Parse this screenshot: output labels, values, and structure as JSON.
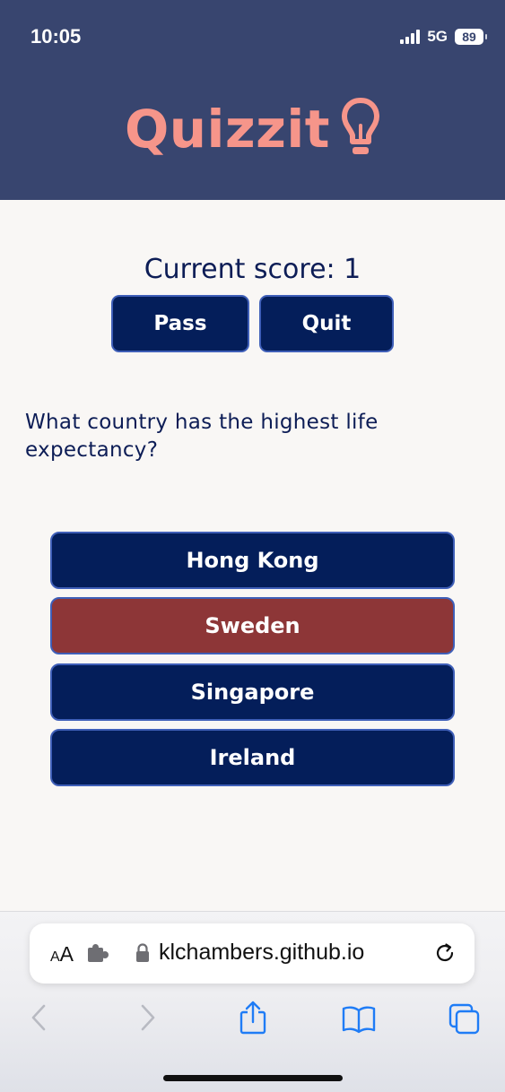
{
  "status_bar": {
    "time": "10:05",
    "network": "5G",
    "battery": "89"
  },
  "header": {
    "brand_title": "Quizzit",
    "brand_icon": "lightbulb-icon",
    "brand_color": "#f6958a",
    "background": "#38456f"
  },
  "game": {
    "score_label": "Current score: 1",
    "pass_label": "Pass",
    "quit_label": "Quit",
    "question": "What country has the highest life expectancy?",
    "answers": [
      {
        "label": "Hong Kong",
        "state": "default"
      },
      {
        "label": "Sweden",
        "state": "wrong"
      },
      {
        "label": "Singapore",
        "state": "default"
      },
      {
        "label": "Ireland",
        "state": "default"
      }
    ],
    "button_color": "#041e5a",
    "wrong_color": "#8d3637"
  },
  "browser": {
    "text_size_small": "A",
    "text_size_large": "A",
    "url": "klchambers.github.io",
    "accent": "#1f7cf6",
    "icons": [
      "extension-icon",
      "lock-icon",
      "reload-icon",
      "back-icon",
      "forward-icon",
      "share-icon",
      "bookmarks-icon",
      "tabs-icon"
    ]
  }
}
